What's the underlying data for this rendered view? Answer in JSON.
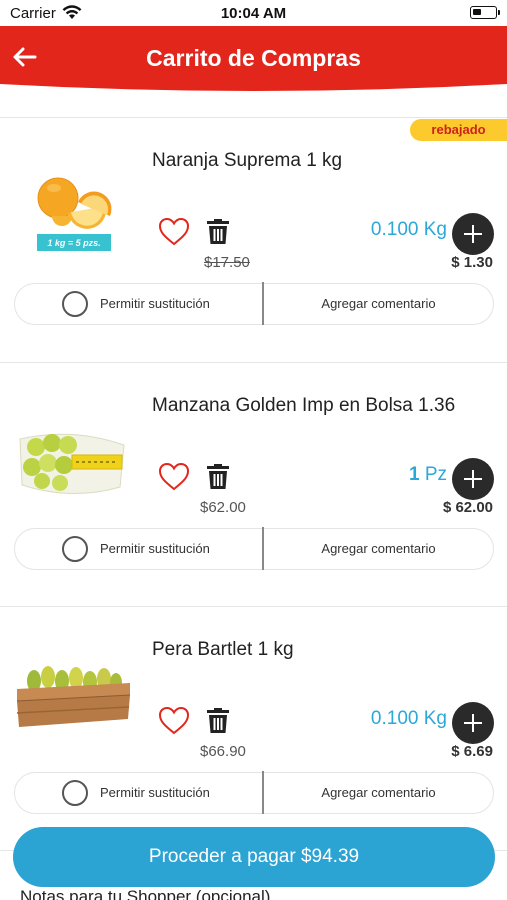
{
  "status_bar": {
    "carrier": "Carrier",
    "time": "10:04 AM"
  },
  "header": {
    "title": "Carrito de Compras",
    "back_icon": "arrow-left-icon",
    "color": "#e3261c"
  },
  "cart": {
    "items": [
      {
        "name": "Naranja Suprema 1 kg",
        "badge": "rebajado",
        "image_caption": "1 kg = 5 pzs.",
        "unit_price": "$17.50",
        "unit_price_struck": true,
        "qty_value": "0.100",
        "qty_unit": "Kg",
        "line_total": "$ 1.30",
        "substitution_label": "Permitir sustitución",
        "comment_label": "Agregar comentario"
      },
      {
        "name": "Manzana Golden Imp en Bolsa 1.36",
        "unit_price": "$62.00",
        "unit_price_struck": false,
        "qty_value": "1",
        "qty_unit": "Pz",
        "line_total": "$ 62.00",
        "substitution_label": "Permitir sustitución",
        "comment_label": "Agregar comentario"
      },
      {
        "name": "Pera Bartlet 1 kg",
        "unit_price": "$66.90",
        "unit_price_struck": false,
        "qty_value": "0.100",
        "qty_unit": "Kg",
        "line_total": "$ 6.69",
        "substitution_label": "Permitir sustitución",
        "comment_label": "Agregar comentario"
      }
    ]
  },
  "checkout": {
    "label": "Proceder a pagar $94.39",
    "color": "#2ba3d3"
  },
  "notes": {
    "label": "Notas para tu Shopper (opcional)"
  },
  "colors": {
    "accent_blue": "#2ba8d8",
    "badge_yellow": "#fdca2e",
    "heart_red": "#e3261c"
  }
}
